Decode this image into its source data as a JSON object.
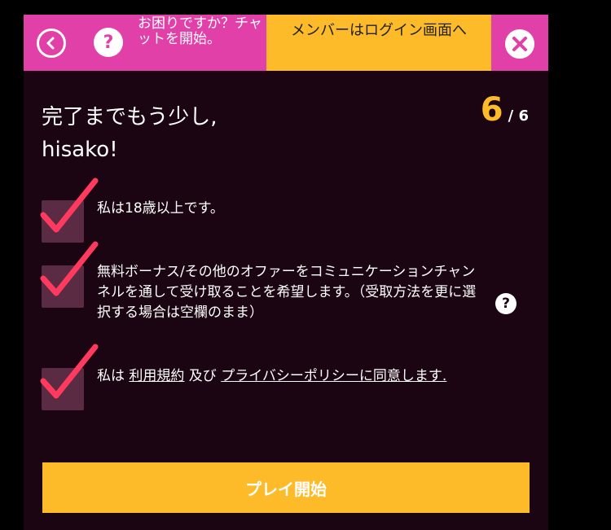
{
  "header": {
    "chat_label": "お困りですか？チャットを開始。",
    "help_symbol": "?",
    "login_label": "メンバーはログイン画面へ",
    "back_icon": "chevron-left-icon",
    "close_icon": "close-icon"
  },
  "title": {
    "line1": "完了までもう少し,",
    "line2": "hisako!"
  },
  "step": {
    "current": "6",
    "total": "/ 6"
  },
  "checkboxes": [
    {
      "label": "私は18歳以上です。",
      "checked": true
    },
    {
      "label": "無料ボーナス/その他のオファーをコミュニケーションチャンネルを通して受け取ることを希望します。（受取方法を更に選択する場合は空欄のまま）",
      "checked": true
    },
    {
      "label_prefix": "私は ",
      "terms_link": "利用規約",
      "middle": " 及び ",
      "privacy_link": "プライバシーポリシー",
      "suffix": "に同意します.",
      "checked": true
    }
  ],
  "info_symbol": "?",
  "submit_label": "プレイ開始",
  "colors": {
    "pink": "#e040a8",
    "yellow": "#fdbb29",
    "background": "#1c0512",
    "checkbox": "#5a2b43",
    "tick": "#ff3a5e"
  }
}
